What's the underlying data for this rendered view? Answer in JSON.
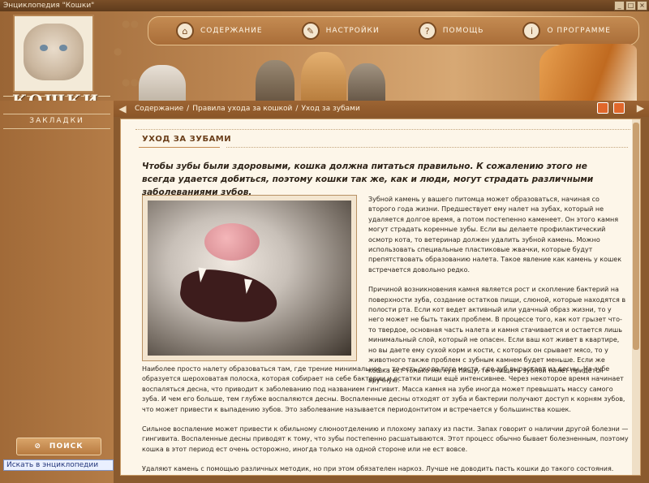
{
  "window": {
    "title": "Энциклопедия \"Кошки\"",
    "buttons": [
      "_",
      "□",
      "×"
    ]
  },
  "logo": {
    "title": "КОШКИ"
  },
  "nav": [
    {
      "label": "СОДЕРЖАНИЕ",
      "icon": "home-icon"
    },
    {
      "label": "НАСТРОЙКИ",
      "icon": "wrench-icon"
    },
    {
      "label": "ПОМОЩЬ",
      "icon": "help-icon"
    },
    {
      "label": "О ПРОГРАММЕ",
      "icon": "info-icon"
    }
  ],
  "sidebar": {
    "bookmarks_label": "ЗАКЛАДКИ",
    "search_label": "ПОИСК",
    "search_input": "Искать в энциклопедии"
  },
  "breadcrumb": {
    "items": [
      "Содержание",
      "Правила ухода за кошкой",
      "Уход за зубами"
    ],
    "separator": " / "
  },
  "article": {
    "title": "УХОД ЗА ЗУБАМИ",
    "lead": "Чтобы зубы были здоровыми, кошка должна питаться правильно. К сожалению этого не всегда удается добиться, поэтому кошки так же, как и люди, могут страдать различными заболеваниями зубов.",
    "para1": "Зубной камень у вашего питомца может образоваться, начиная со второго года жизни. Предшествует ему налет на зубах, который не удаляется долгое время, а потом постепенно каменеет. Он этого камня могут страдать коренные зубы. Если вы делаете профилактический осмотр кота, то ветеринар должен удалить зубной камень. Можно использовать специальные пластиковые жвачки, которые будут препятствовать образованию налета. Такое явление как камень у кошек встречается довольно редко.",
    "para2": "Причиной возникновения камня является рост и скопление бактерий на поверхности зуба, создание остатков пищи, слюной, которые находятся в полости рта. Если кот ведет активный или удачный образ жизни, то у него может не быть таких проблем. В процессе того, как кот грызет что-то твердое, основная часть налета и камня стачивается и остается лишь минимальный слой, который не опасен. Если ваш кот живет в квартире, но вы даете ему сухой корм и кости, с которых он срывает мясо, то у животного также проблем с зубным камнем будет меньше. Если же кошка ест только мягкую пищу, то очищать зубной налет придется вручную.",
    "para3": "Наиболее просто налету образоваться там, где трение минимальное — то есть около того места, где зуб вырастает из десны. На зубе образуется шероховатая полоска, которая собирает на себе бактерии и остатки пищи ещё интенсивнее. Через некоторое время начинает воспаляться десна, что приводит к заболеванию под названием гингивит. Масса камня на зубе иногда может превышать массу самого зуба. И чем его больше, тем глубже воспаляются десны. Воспаленные десны отходят от зуба и бактерии получают доступ к корням зубов, что может привести к выпадению зубов. Это заболевание называется периодонтитом и встречается у большинства кошек.",
    "para4": "Сильное воспаление может привести к обильному слюноотделению и плохому запаху из пасти. Запах говорит о наличии другой болезни — гингивита. Воспаленные десны приводят к тому, что зубы постепенно расшатываются. Этот процесс обычно бывает болезненным, поэтому кошка в этот период ест очень осторожно, иногда только на одной стороне или не ест вовсе.",
    "para5": "Удаляют камень с помощью различных методик, но при этом обязателен наркоз. Лучше не доводить пасть кошки до такого состояния."
  }
}
